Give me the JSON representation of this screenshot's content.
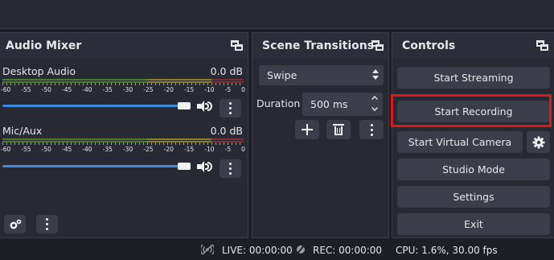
{
  "audio_mixer": {
    "title": "Audio Mixer",
    "scale": [
      "-60",
      "-55",
      "-50",
      "-45",
      "-40",
      "-35",
      "-30",
      "-25",
      "-20",
      "-15",
      "-10",
      "-5",
      "0"
    ],
    "channels": [
      {
        "name": "Desktop Audio",
        "db": "0.0 dB",
        "volume_level": 1.0
      },
      {
        "name": "Mic/Aux",
        "db": "0.0 dB",
        "volume_level": 1.0
      }
    ]
  },
  "scene_transitions": {
    "title": "Scene Transitions",
    "selected_transition": "Swipe",
    "duration_label": "Duration",
    "duration_value": "500 ms"
  },
  "controls": {
    "title": "Controls",
    "start_streaming": "Start Streaming",
    "start_recording": "Start Recording",
    "start_virtual_camera": "Start Virtual Camera",
    "studio_mode": "Studio Mode",
    "settings": "Settings",
    "exit": "Exit"
  },
  "status_bar": {
    "live": "LIVE: 00:00:00",
    "rec": "REC: 00:00:00",
    "cpu": "CPU: 1.6%, 30.00 fps"
  },
  "colors": {
    "highlight": "#e0161b",
    "slider": "#3c8ad9",
    "meter_green": "#4a7a2a",
    "meter_yellow": "#8a7d2a",
    "meter_red": "#7a2e32"
  },
  "icons": [
    "undock-icon",
    "volume-icon",
    "more-vertical-icon",
    "plus-icon",
    "trash-icon",
    "gear-icon",
    "advanced-audio-icon",
    "live-signal-icon",
    "record-icon",
    "chevron-up-icon",
    "chevron-down-icon"
  ]
}
